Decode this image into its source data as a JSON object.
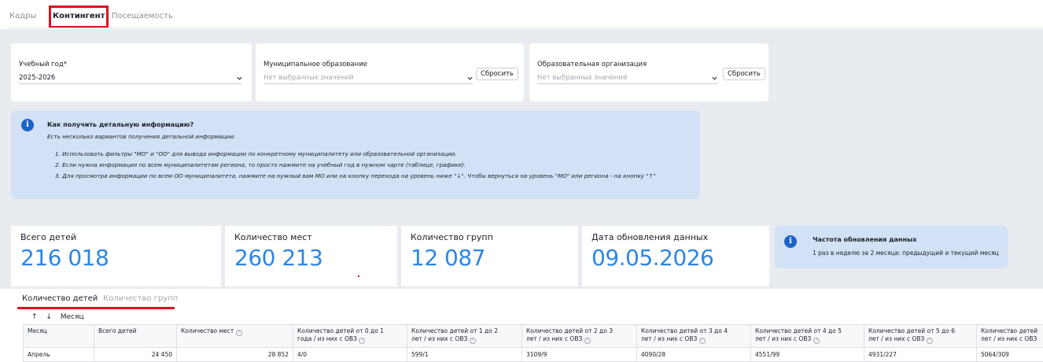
{
  "nav": {
    "tabs": [
      {
        "label": "Кадры"
      },
      {
        "label": "Контингент"
      },
      {
        "label": "Посещаемость"
      }
    ]
  },
  "filters": {
    "year": {
      "label": "Учебный год*",
      "value": "2025-2026"
    },
    "municipality": {
      "label": "Муниципальное образование",
      "placeholder": "Нет выбранных значений",
      "reset": "Сбросить"
    },
    "organization": {
      "label": "Образовательная организация",
      "placeholder": "Нет выбранных значений",
      "reset": "Сбросить"
    }
  },
  "info": {
    "title": "Как получить детальную информацию?",
    "subtitle": "Есть несколько вариантов получения детальной информации:",
    "lines": [
      "1. Использовать фильтры \"МО\" и \"ОО\" для вывода информации по конкретному муниципалитету или образовательной организации.",
      "2. Если нужна информация по всем муниципалитетам региона, то просто нажмите на учебный год в нужном чарте (таблице, графике).",
      "3. Для просмотра информации по всем ОО муниципалитета, нажмите на нужный вам МО или на кнопку перехода на уровень ниже \"↓\". Чтобы вернуться на уровень \"МО\" или региона - на кнопку \"↑\""
    ]
  },
  "stats": [
    {
      "label": "Всего детей",
      "value": "216 018"
    },
    {
      "label": "Количество мест",
      "value": "260 213"
    },
    {
      "label": "Количество групп",
      "value": "12 087"
    },
    {
      "label": "Дата обновления данных",
      "value": "09.05.2026"
    }
  ],
  "frequency": {
    "title": "Частота обновления данных",
    "text": "1 раз в неделю за 2 месяца: предыдущий и текущий месяц"
  },
  "subtabs": [
    {
      "label": "Количество детей"
    },
    {
      "label": "Количество групп"
    }
  ],
  "sort": {
    "up": "↑",
    "down": "↓",
    "label": "Месяц"
  },
  "table": {
    "headers": [
      {
        "line1": "Месяц",
        "line2": ""
      },
      {
        "line1": "Всего детей",
        "line2": ""
      },
      {
        "line1": "Количество мест",
        "line2": ""
      },
      {
        "line1": "Количество детей от 0 до 1",
        "line2": "года / из них с ОВЗ"
      },
      {
        "line1": "Количество детей от 1 до 2",
        "line2": "лет / из них с ОВЗ"
      },
      {
        "line1": "Количество детей от 2 до 3",
        "line2": "лет / из них с ОВЗ"
      },
      {
        "line1": "Количество детей от 3 до 4",
        "line2": "лет / из них с ОВЗ"
      },
      {
        "line1": "Количество детей от 4 до 5",
        "line2": "лет / из них с ОВЗ"
      },
      {
        "line1": "Количество детей от 5 до 6",
        "line2": "лет / из них с ОВЗ"
      },
      {
        "line1": "Количество детей",
        "line2": "лет / из них с ОВЗ"
      }
    ],
    "row": [
      "Апрель",
      "24 450",
      "28 852",
      "4/0",
      "599/1",
      "3109/9",
      "4090/28",
      "4551/99",
      "4931/227",
      "5064/309"
    ]
  },
  "colors": {
    "accent": "#2b86e6",
    "highlight": "#e0101e",
    "info_bg": "#d2e1f5",
    "info_icon": "#1a64c8"
  }
}
